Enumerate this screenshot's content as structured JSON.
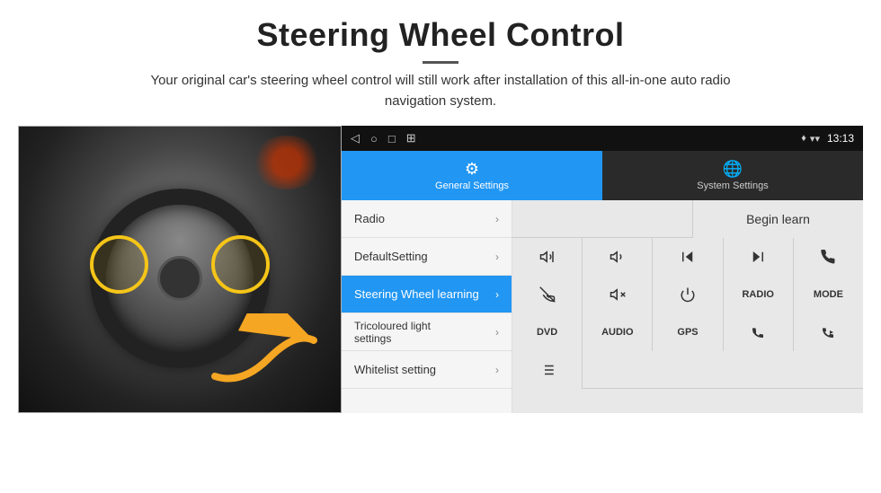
{
  "page": {
    "title": "Steering Wheel Control",
    "subtitle": "Your original car's steering wheel control will still work after installation of this all-in-one auto radio navigation system.",
    "divider": "—"
  },
  "status_bar": {
    "nav_back": "◁",
    "nav_home": "○",
    "nav_square": "□",
    "nav_menu": "⊞",
    "signal": "▾▾",
    "wifi": "▿",
    "time": "13:13"
  },
  "tabs": [
    {
      "id": "general",
      "label": "General Settings",
      "icon": "⚙",
      "active": true
    },
    {
      "id": "system",
      "label": "System Settings",
      "icon": "🌐",
      "active": false
    }
  ],
  "menu_items": [
    {
      "id": "radio",
      "label": "Radio",
      "active": false
    },
    {
      "id": "default",
      "label": "DefaultSetting",
      "active": false
    },
    {
      "id": "steering",
      "label": "Steering Wheel learning",
      "active": true
    },
    {
      "id": "tricoloured",
      "label": "Tricoloured light settings",
      "active": false
    },
    {
      "id": "whitelist",
      "label": "Whitelist setting",
      "active": false
    }
  ],
  "controls": {
    "begin_learn": "Begin learn",
    "row2": [
      {
        "id": "vol_up",
        "label": "🔊+"
      },
      {
        "id": "vol_down",
        "label": "🔈-"
      },
      {
        "id": "prev_track",
        "label": "⏮"
      },
      {
        "id": "next_track",
        "label": "⏭"
      },
      {
        "id": "phone",
        "label": "📞"
      }
    ],
    "row3": [
      {
        "id": "hang_up",
        "label": "↩"
      },
      {
        "id": "mute",
        "label": "🔇x"
      },
      {
        "id": "power",
        "label": "⏻"
      },
      {
        "id": "radio_btn",
        "label": "RADIO"
      },
      {
        "id": "mode_btn",
        "label": "MODE"
      }
    ],
    "row4": [
      {
        "id": "dvd",
        "label": "DVD"
      },
      {
        "id": "audio",
        "label": "AUDIO"
      },
      {
        "id": "gps",
        "label": "GPS"
      },
      {
        "id": "phone_prev",
        "label": "📞⏮"
      },
      {
        "id": "phone_next",
        "label": "📞⏭"
      }
    ],
    "row5": [
      {
        "id": "list_icon",
        "label": "☰"
      }
    ]
  }
}
